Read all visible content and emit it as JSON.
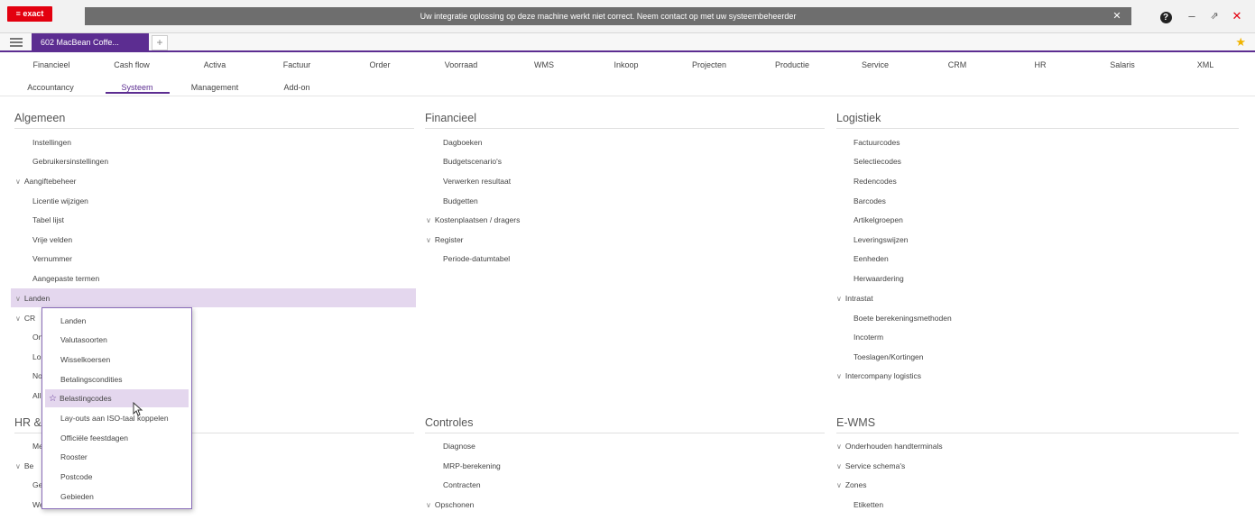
{
  "app": {
    "logo": "≡ exact",
    "notice": "Uw integratie oplossing op deze machine werkt niet correct. Neem contact op met uw systeembeheerder",
    "window_controls": {
      "help": "?",
      "minimize": "–",
      "restore": "⇗",
      "close": "✕"
    }
  },
  "tabs": {
    "active": "602 MacBean Coffe...",
    "add": "+"
  },
  "menu": {
    "row1": [
      "Financieel",
      "Cash flow",
      "Activa",
      "Factuur",
      "Order",
      "Voorraad",
      "WMS",
      "Inkoop",
      "Projecten",
      "Productie",
      "Service",
      "CRM",
      "HR",
      "Salaris",
      "XML"
    ],
    "row2": [
      "Accountancy",
      "Systeem",
      "Management",
      "Add-on"
    ],
    "active": "Systeem"
  },
  "sections": {
    "algemeen": {
      "title": "Algemeen",
      "items": [
        {
          "label": "Instellingen",
          "chevron": ""
        },
        {
          "label": "Gebruikersinstellingen",
          "chevron": ""
        },
        {
          "label": "Aangiftebeheer",
          "chevron": "∨"
        },
        {
          "label": "Licentie wijzigen",
          "chevron": ""
        },
        {
          "label": "Tabel lijst",
          "chevron": ""
        },
        {
          "label": "Vrije velden",
          "chevron": ""
        },
        {
          "label": "Vernummer",
          "chevron": ""
        },
        {
          "label": "Aangepaste termen",
          "chevron": ""
        },
        {
          "label": "Landen",
          "chevron": "∨"
        },
        {
          "label": "CR",
          "chevron": "∨"
        },
        {
          "label": "On",
          "chevron": ""
        },
        {
          "label": "Lo",
          "chevron": ""
        },
        {
          "label": "No",
          "chevron": ""
        },
        {
          "label": "All",
          "chevron": ""
        }
      ]
    },
    "hr": {
      "title": "HR &",
      "items": [
        {
          "label": "Me",
          "chevron": ""
        },
        {
          "label": "Be",
          "chevron": "∨"
        },
        {
          "label": "Gel",
          "chevron": ""
        },
        {
          "label": "We",
          "chevron": ""
        }
      ]
    },
    "financieel": {
      "title": "Financieel",
      "items": [
        {
          "label": "Dagboeken",
          "chevron": ""
        },
        {
          "label": "Budgetscenario's",
          "chevron": ""
        },
        {
          "label": "Verwerken resultaat",
          "chevron": ""
        },
        {
          "label": "Budgetten",
          "chevron": ""
        },
        {
          "label": "Kostenplaatsen / dragers",
          "chevron": "∨"
        },
        {
          "label": "Register",
          "chevron": "∨"
        },
        {
          "label": "Periode-datumtabel",
          "chevron": ""
        }
      ]
    },
    "controles": {
      "title": "Controles",
      "items": [
        {
          "label": "Diagnose",
          "chevron": ""
        },
        {
          "label": "MRP-berekening",
          "chevron": ""
        },
        {
          "label": "Contracten",
          "chevron": ""
        },
        {
          "label": "Opschonen",
          "chevron": "∨"
        }
      ]
    },
    "logistiek": {
      "title": "Logistiek",
      "items": [
        {
          "label": "Factuurcodes",
          "chevron": ""
        },
        {
          "label": "Selectiecodes",
          "chevron": ""
        },
        {
          "label": "Redencodes",
          "chevron": ""
        },
        {
          "label": "Barcodes",
          "chevron": ""
        },
        {
          "label": "Artikelgroepen",
          "chevron": ""
        },
        {
          "label": "Leveringswijzen",
          "chevron": ""
        },
        {
          "label": "Eenheden",
          "chevron": ""
        },
        {
          "label": "Herwaardering",
          "chevron": ""
        },
        {
          "label": "Intrastat",
          "chevron": "∨"
        },
        {
          "label": "Boete berekeningsmethoden",
          "chevron": ""
        },
        {
          "label": "Incoterm",
          "chevron": ""
        },
        {
          "label": "Toeslagen/Kortingen",
          "chevron": ""
        },
        {
          "label": "Intercompany logistics",
          "chevron": "∨"
        }
      ]
    },
    "ewms": {
      "title": "E-WMS",
      "items": [
        {
          "label": "Onderhouden handterminals",
          "chevron": "∨"
        },
        {
          "label": "Service schema's",
          "chevron": "∨"
        },
        {
          "label": "Zones",
          "chevron": "∨"
        },
        {
          "label": "Etiketten",
          "chevron": ""
        }
      ]
    }
  },
  "dropdown": {
    "items": [
      "Landen",
      "Valutasoorten",
      "Wisselkoersen",
      "Betalingscondities",
      "Belastingcodes",
      "Lay-outs aan ISO-taal koppelen",
      "Officiële feestdagen",
      "Rooster",
      "Postcode",
      "Gebieden"
    ],
    "hovered": "Belastingcodes",
    "hover_icon": "☆"
  },
  "colors": {
    "accent": "#5c2d91",
    "highlight": "#e4d7ee",
    "brand_red": "#e3000f"
  }
}
